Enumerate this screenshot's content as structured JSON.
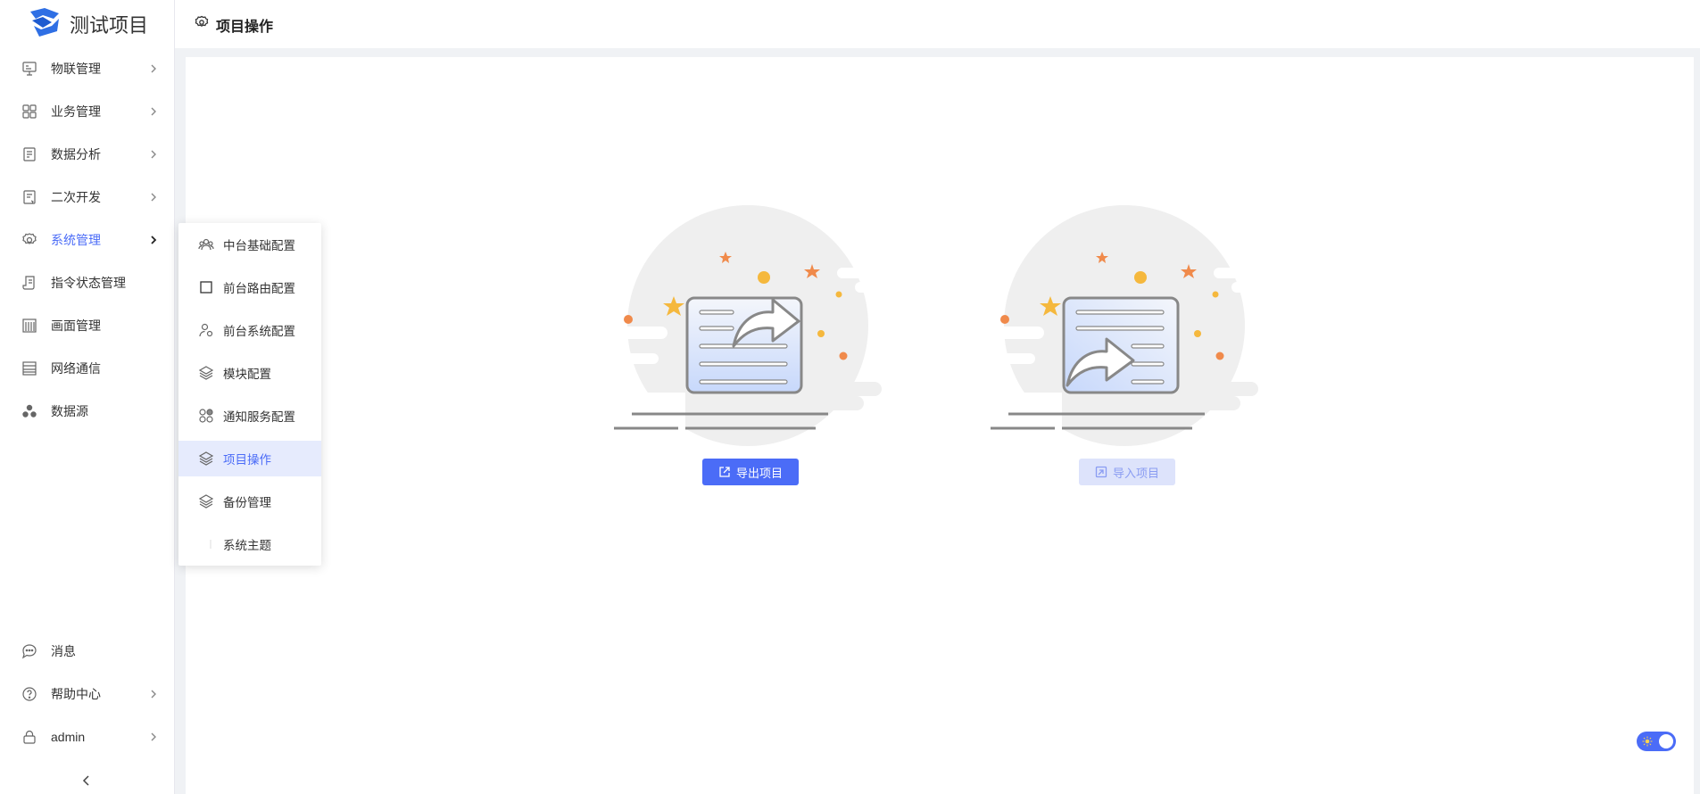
{
  "brand": {
    "title": "测试项目"
  },
  "header": {
    "title": "项目操作",
    "icon": "gear-icon"
  },
  "sidebar": {
    "items": [
      {
        "label": "物联管理",
        "icon": "monitor-icon",
        "has_arrow": true
      },
      {
        "label": "业务管理",
        "icon": "grid-icon",
        "has_arrow": true
      },
      {
        "label": "数据分析",
        "icon": "chart-doc-icon",
        "has_arrow": true
      },
      {
        "label": "二次开发",
        "icon": "code-doc-icon",
        "has_arrow": true
      },
      {
        "label": "系统管理",
        "icon": "gear-icon",
        "has_arrow": true,
        "active": true
      },
      {
        "label": "指令状态管理",
        "icon": "scroll-icon",
        "has_arrow": false
      },
      {
        "label": "画面管理",
        "icon": "building-icon",
        "has_arrow": false
      },
      {
        "label": "网络通信",
        "icon": "list-icon",
        "has_arrow": false
      },
      {
        "label": "数据源",
        "icon": "cluster-icon",
        "has_arrow": false
      }
    ],
    "bottom_items": [
      {
        "label": "消息",
        "icon": "chat-icon",
        "has_arrow": false
      },
      {
        "label": "帮助中心",
        "icon": "help-icon",
        "has_arrow": true
      },
      {
        "label": "admin",
        "icon": "lock-icon",
        "has_arrow": true
      }
    ]
  },
  "submenu": {
    "items": [
      {
        "label": "中台基础配置",
        "icon": "users-icon"
      },
      {
        "label": "前台路由配置",
        "icon": "square-icon"
      },
      {
        "label": "前台系统配置",
        "icon": "user-gear-icon"
      },
      {
        "label": "模块配置",
        "icon": "layers-icon"
      },
      {
        "label": "通知服务配置",
        "icon": "apps-icon"
      },
      {
        "label": "项目操作",
        "icon": "layers-icon",
        "active": true
      },
      {
        "label": "备份管理",
        "icon": "layers-icon"
      },
      {
        "label": "系统主题",
        "icon": ""
      }
    ]
  },
  "main": {
    "export_button": "导出项目",
    "import_button": "导入项目"
  },
  "colors": {
    "accent": "#4b6cf7",
    "active_bg": "#e6ebfd",
    "star_gold": "#f5b83d",
    "star_orange": "#f08a4b"
  }
}
